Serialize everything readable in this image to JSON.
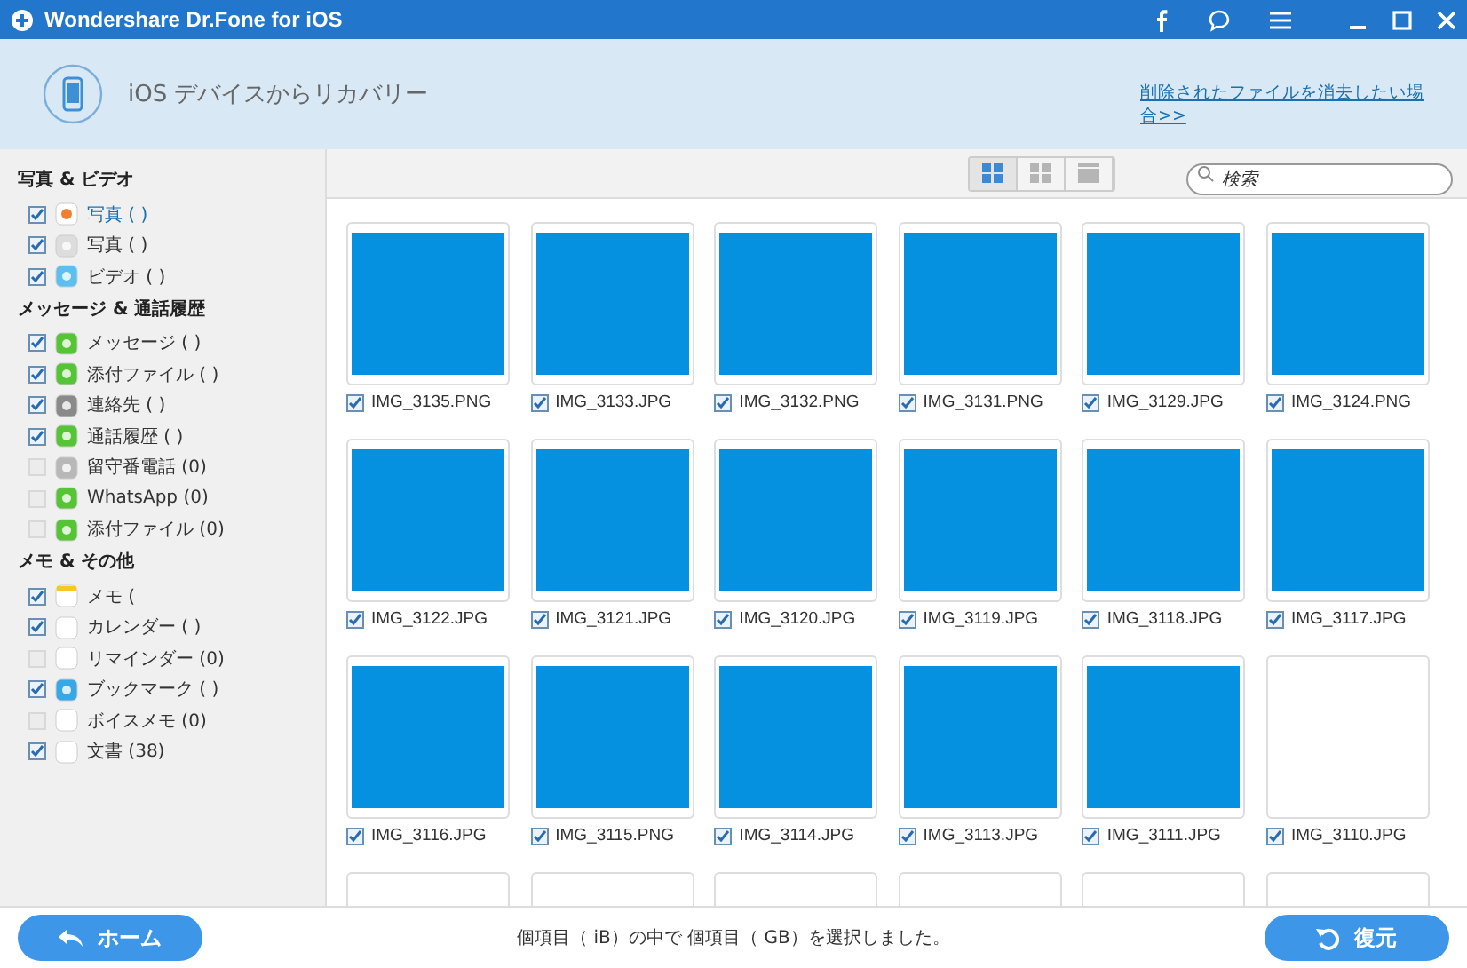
{
  "window": {
    "title": "Wondershare Dr.Fone for iOS"
  },
  "header": {
    "title": "iOS デバイスからリカバリー",
    "link": "削除されたファイルを消去したい場合>>"
  },
  "sidebar": [
    {
      "heading": "写真 & ビデオ",
      "items": [
        {
          "label": "写真 (   )",
          "checked": true,
          "selected": true,
          "kind": "photos"
        },
        {
          "label": "写真 (   )",
          "checked": true,
          "selected": false,
          "kind": "camera"
        },
        {
          "label": "ビデオ (  )",
          "checked": true,
          "selected": false,
          "kind": "video"
        }
      ]
    },
    {
      "heading": "メッセージ & 通話履歴",
      "items": [
        {
          "label": "メッセージ (  )",
          "checked": true,
          "selected": false,
          "kind": "message"
        },
        {
          "label": "添付ファイル (    )",
          "checked": true,
          "selected": false,
          "kind": "attach"
        },
        {
          "label": "連絡先 (   )",
          "checked": true,
          "selected": false,
          "kind": "contact"
        },
        {
          "label": "通話履歴 (   )",
          "checked": true,
          "selected": false,
          "kind": "call"
        },
        {
          "label": "留守番電話 (0)",
          "checked": false,
          "selected": false,
          "kind": "voicemail"
        },
        {
          "label": "WhatsApp (0)",
          "checked": false,
          "selected": false,
          "kind": "whatsapp"
        },
        {
          "label": "添付ファイル (0)",
          "checked": false,
          "selected": false,
          "kind": "attach"
        }
      ]
    },
    {
      "heading": "メモ & その他",
      "items": [
        {
          "label": "メモ (  ",
          "checked": true,
          "selected": false,
          "kind": "note"
        },
        {
          "label": "カレンダー (   )",
          "checked": true,
          "selected": false,
          "kind": "calendar"
        },
        {
          "label": "リマインダー (0)",
          "checked": false,
          "selected": false,
          "kind": "reminder"
        },
        {
          "label": "ブックマーク (  )",
          "checked": true,
          "selected": false,
          "kind": "bookmark"
        },
        {
          "label": "ボイスメモ (0)",
          "checked": false,
          "selected": false,
          "kind": "voice"
        },
        {
          "label": "文書 (38)",
          "checked": true,
          "selected": false,
          "kind": "doc"
        }
      ]
    }
  ],
  "toolbar": {
    "views": [
      {
        "selected": true
      },
      {
        "selected": false
      },
      {
        "selected": false
      }
    ],
    "search": {
      "placeholder": "検索"
    }
  },
  "files": [
    {
      "name": "IMG_3135.PNG",
      "checked": true,
      "kind": "image"
    },
    {
      "name": "IMG_3133.JPG",
      "checked": true,
      "kind": "image"
    },
    {
      "name": "IMG_3132.PNG",
      "checked": true,
      "kind": "image"
    },
    {
      "name": "IMG_3131.PNG",
      "checked": true,
      "kind": "image"
    },
    {
      "name": "IMG_3129.JPG",
      "checked": true,
      "kind": "image"
    },
    {
      "name": "IMG_3124.PNG",
      "checked": true,
      "kind": "image"
    },
    {
      "name": "IMG_3122.JPG",
      "checked": true,
      "kind": "image"
    },
    {
      "name": "IMG_3121.JPG",
      "checked": true,
      "kind": "image"
    },
    {
      "name": "IMG_3120.JPG",
      "checked": true,
      "kind": "image"
    },
    {
      "name": "IMG_3119.JPG",
      "checked": true,
      "kind": "image"
    },
    {
      "name": "IMG_3118.JPG",
      "checked": true,
      "kind": "image"
    },
    {
      "name": "IMG_3117.JPG",
      "checked": true,
      "kind": "image"
    },
    {
      "name": "IMG_3116.JPG",
      "checked": true,
      "kind": "image"
    },
    {
      "name": "IMG_3115.PNG",
      "checked": true,
      "kind": "image"
    },
    {
      "name": "IMG_3114.JPG",
      "checked": true,
      "kind": "image"
    },
    {
      "name": "IMG_3113.JPG",
      "checked": true,
      "kind": "image"
    },
    {
      "name": "IMG_3111.JPG",
      "checked": true,
      "kind": "image"
    },
    {
      "name": "IMG_3110.JPG",
      "checked": true,
      "kind": "blank"
    }
  ],
  "footer": {
    "home": "ホーム",
    "status": "個項目（ iB）の中で 個項目（ GB）を選択しました。",
    "recover": "復元"
  }
}
